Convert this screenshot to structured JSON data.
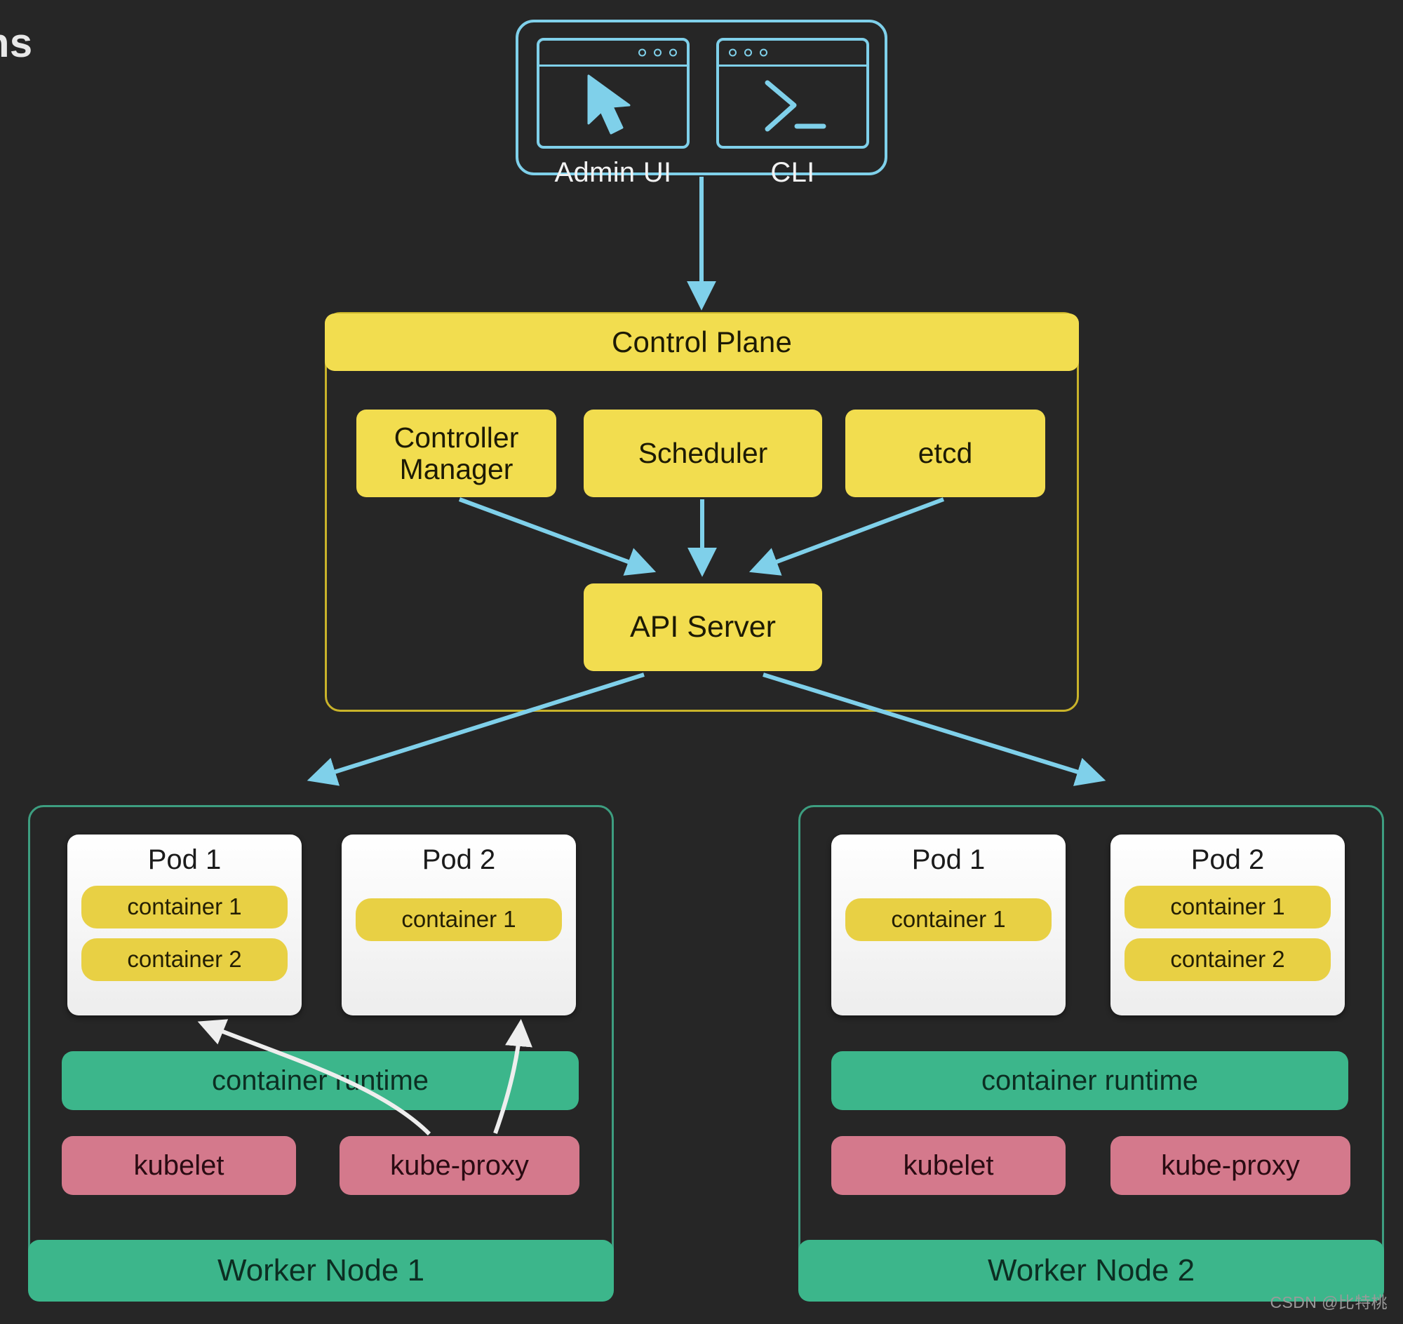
{
  "page": {
    "background_color": "#262626",
    "cropped_heading_fragment": "ns",
    "watermark": "CSDN @比特桃"
  },
  "colors": {
    "client_outline": "#7fd0ea",
    "arrow_blue": "#7fd0ea",
    "control_plane_yellow": "#f2dd4f",
    "control_plane_border": "#c9b32a",
    "container_chip_yellow": "#e8d044",
    "node_border_green": "#3d9e80",
    "runtime_green": "#3cb68b",
    "service_pink": "#d4798c",
    "pod_white": "#ffffff",
    "white_arrow": "#eeeeee"
  },
  "clients": {
    "items": [
      {
        "id": "admin-ui",
        "label": "Admin UI",
        "icon": "cursor-arrow-icon",
        "window_dots": 3
      },
      {
        "id": "cli",
        "label": "CLI",
        "icon": "terminal-prompt-icon",
        "window_dots": 3
      }
    ]
  },
  "control_plane": {
    "title": "Control Plane",
    "components": [
      {
        "id": "controller-manager",
        "label": "Controller\nManager",
        "line1": "Controller",
        "line2": "Manager"
      },
      {
        "id": "scheduler",
        "label": "Scheduler"
      },
      {
        "id": "etcd",
        "label": "etcd"
      }
    ],
    "api_server": {
      "id": "api-server",
      "label": "API Server"
    }
  },
  "worker_nodes": [
    {
      "id": "worker-node-1",
      "footer_label": "Worker Node 1",
      "pods": [
        {
          "id": "node1-pod1",
          "title": "Pod 1",
          "containers": [
            "container 1",
            "container 2"
          ]
        },
        {
          "id": "node1-pod2",
          "title": "Pod 2",
          "containers": [
            "container 1"
          ]
        }
      ],
      "runtime_label": "container runtime",
      "services": [
        "kubelet",
        "kube-proxy"
      ]
    },
    {
      "id": "worker-node-2",
      "footer_label": "Worker Node 2",
      "pods": [
        {
          "id": "node2-pod1",
          "title": "Pod 1",
          "containers": [
            "container 1"
          ]
        },
        {
          "id": "node2-pod2",
          "title": "Pod 2",
          "containers": [
            "container 1",
            "container 2"
          ]
        }
      ],
      "runtime_label": "container runtime",
      "services": [
        "kubelet",
        "kube-proxy"
      ]
    }
  ],
  "connections": [
    {
      "from": "clients",
      "to": "control-plane",
      "style": "blue-arrow"
    },
    {
      "from": "controller-manager",
      "to": "api-server",
      "style": "blue-arrow"
    },
    {
      "from": "scheduler",
      "to": "api-server",
      "style": "blue-arrow"
    },
    {
      "from": "etcd",
      "to": "api-server",
      "style": "blue-arrow"
    },
    {
      "from": "api-server",
      "to": "worker-node-1",
      "style": "blue-arrow"
    },
    {
      "from": "api-server",
      "to": "worker-node-2",
      "style": "blue-arrow"
    },
    {
      "from": "node1-kube-proxy",
      "to": "node1-pod1",
      "style": "white-curve-arrow"
    },
    {
      "from": "node1-kube-proxy",
      "to": "node1-pod2",
      "style": "white-curve-arrow"
    }
  ]
}
